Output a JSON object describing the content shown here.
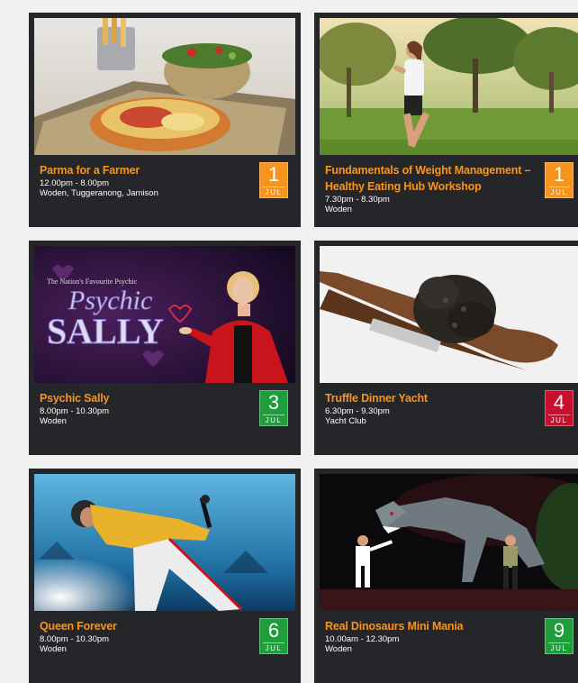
{
  "events": [
    {
      "title": "Parma for a Farmer",
      "time": "12.00pm - 8.00pm",
      "venue": "Woden, Tuggeranong, Jamison",
      "day": "1",
      "month": "JUL",
      "date_color": "#f7941d",
      "image": "parma-dish"
    },
    {
      "title": "Fundamentals of Weight Management – Healthy Eating Hub Workshop",
      "time": "7.30pm - 8.30pm",
      "venue": "Woden",
      "day": "1",
      "month": "JUL",
      "date_color": "#f7941d",
      "image": "woman-jogging"
    },
    {
      "title": "Psychic Sally",
      "time": "8.00pm - 10.30pm",
      "venue": "Woden",
      "day": "3",
      "month": "JUL",
      "date_color": "#1e9e3b",
      "image": "psychic-sally-promo",
      "image_text": {
        "tagline": "The Nation's Favourite Psychic",
        "line1": "Psychic",
        "line2": "SALLY"
      }
    },
    {
      "title": "Truffle Dinner Yacht",
      "time": "6.30pm - 9.30pm",
      "venue": "Yacht Club",
      "day": "4",
      "month": "JUL",
      "date_color": "#c8102e",
      "image": "truffle"
    },
    {
      "title": "Queen Forever",
      "time": "8.00pm - 10.30pm",
      "venue": "Woden",
      "day": "6",
      "month": "JUL",
      "date_color": "#1e9e3b",
      "image": "singer-stage"
    },
    {
      "title": "Real Dinosaurs Mini Mania",
      "time": "10.00am - 12.30pm",
      "venue": "Woden",
      "day": "9",
      "month": "JUL",
      "date_color": "#1e9e3b",
      "image": "dinosaur-show"
    }
  ]
}
